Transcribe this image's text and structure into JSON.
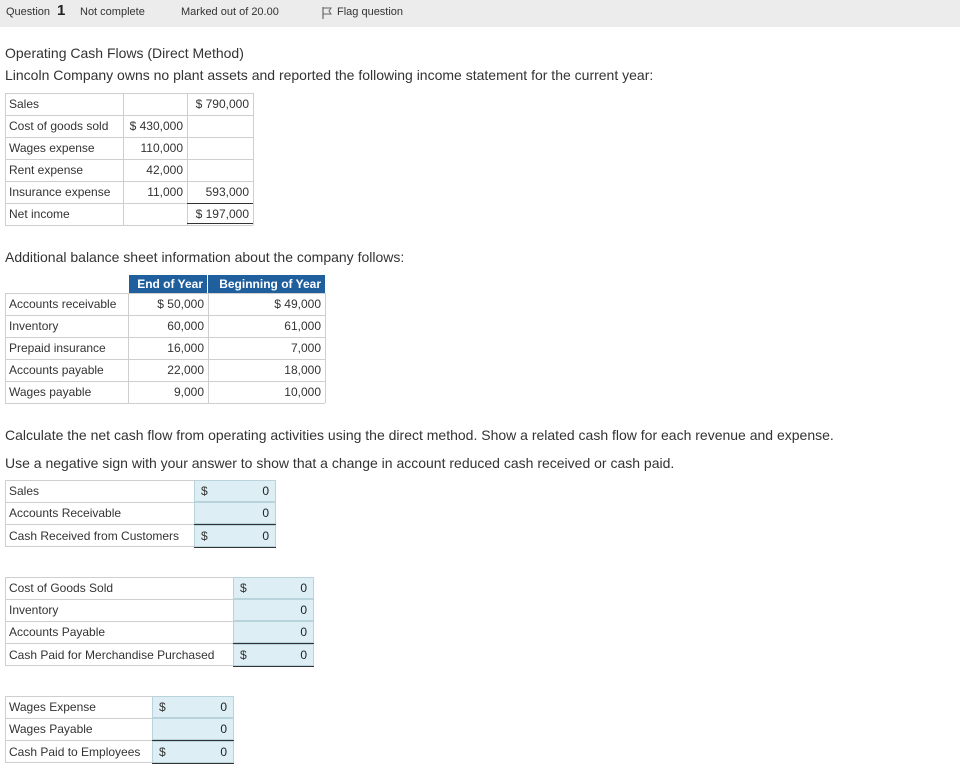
{
  "question_bar": {
    "question_label": "Question",
    "question_number": "1",
    "status": "Not complete",
    "marks": "Marked out of 20.00",
    "flag_label": "Flag question"
  },
  "content": {
    "title": "Operating Cash Flows (Direct Method)",
    "intro": "Lincoln Company owns no plant assets and reported the following income statement for the current year:",
    "balance_intro": "Additional balance sheet information about the company follows:",
    "instruction1": "Calculate the net cash flow from operating activities using the direct method. Show a related cash flow for each revenue and expense.",
    "instruction2": "Use a negative sign with your answer to show that a change in account reduced cash received or cash paid."
  },
  "income_statement": [
    {
      "label": "Sales",
      "col1": "",
      "col2": "$ 790,000"
    },
    {
      "label": "Cost of goods sold",
      "col1": "$ 430,000",
      "col2": ""
    },
    {
      "label": "Wages expense",
      "col1": "110,000",
      "col2": ""
    },
    {
      "label": "Rent expense",
      "col1": "42,000",
      "col2": ""
    },
    {
      "label": "Insurance expense",
      "col1": "11,000",
      "col2": "593,000"
    },
    {
      "label": "Net income",
      "col1": "",
      "col2": "$ 197,000"
    }
  ],
  "balance_sheet": {
    "headers": [
      "End of Year",
      "Beginning of Year"
    ],
    "rows": [
      {
        "label": "Accounts receivable",
        "end": "$ 50,000",
        "begin": "$ 49,000"
      },
      {
        "label": "Inventory",
        "end": "60,000",
        "begin": "61,000"
      },
      {
        "label": "Prepaid insurance",
        "end": "16,000",
        "begin": "7,000"
      },
      {
        "label": "Accounts payable",
        "end": "22,000",
        "begin": "18,000"
      },
      {
        "label": "Wages payable",
        "end": "9,000",
        "begin": "10,000"
      }
    ]
  },
  "customers_table": [
    {
      "label": "Sales",
      "dollar": "$",
      "value": "0"
    },
    {
      "label": "Accounts Receivable",
      "dollar": "",
      "value": "0"
    },
    {
      "label": "Cash Received from Customers",
      "dollar": "$",
      "value": "0"
    }
  ],
  "merchandise_table": [
    {
      "label": "Cost of Goods Sold",
      "dollar": "$",
      "value": "0"
    },
    {
      "label": "Inventory",
      "dollar": "",
      "value": "0"
    },
    {
      "label": "Accounts Payable",
      "dollar": "",
      "value": "0"
    },
    {
      "label": "Cash Paid for Merchandise Purchased",
      "dollar": "$",
      "value": "0"
    }
  ],
  "employees_table": [
    {
      "label": "Wages Expense",
      "dollar": "$",
      "value": "0"
    },
    {
      "label": "Wages Payable",
      "dollar": "",
      "value": "0"
    },
    {
      "label": "Cash Paid to Employees",
      "dollar": "$",
      "value": "0"
    }
  ],
  "colors": {
    "header_blue": "#1f5f9e",
    "input_fill": "#ddeef4"
  }
}
